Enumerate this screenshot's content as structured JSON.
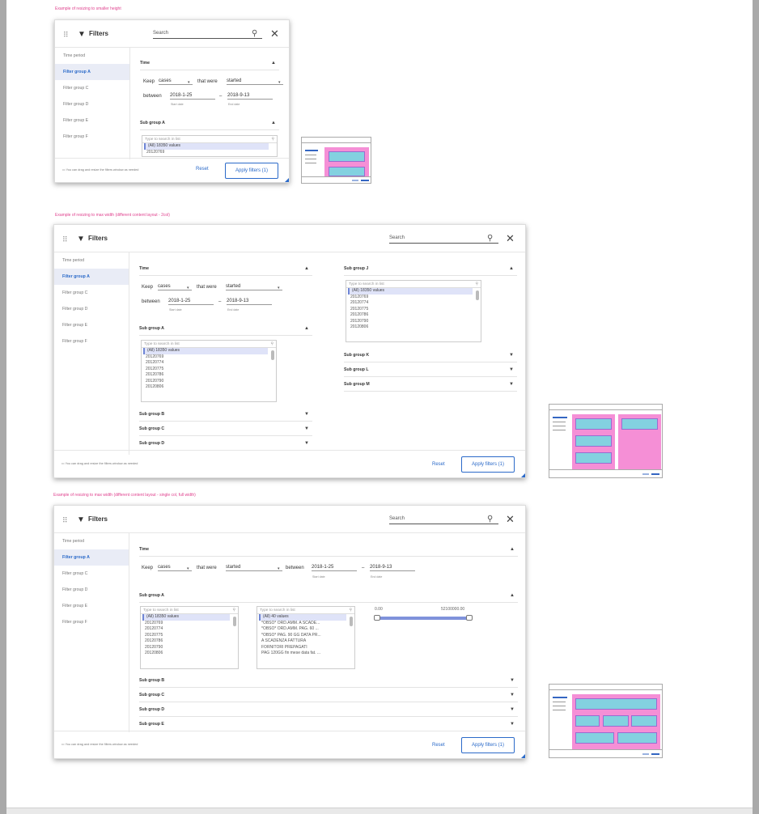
{
  "sections": [
    {
      "title": "Example of resizing to smaller height"
    },
    {
      "title": "Example of resizing to max width (different content layout - 2col)"
    },
    {
      "title": "Example of resizing to max width (different content layout - single col, full width)"
    }
  ],
  "common": {
    "title": "Filters",
    "search_placeholder": "Search",
    "sidebar": [
      "Time period",
      "Filter group A",
      "Filter group C",
      "Filter group D",
      "Filter group E",
      "Filter group F"
    ],
    "time_label": "Time",
    "keep": "Keep",
    "cases": "cases",
    "that_were": "that were",
    "started": "started",
    "between": "between",
    "start_date": "2018-1-25",
    "dash": "–",
    "end_date": "2018-9-13",
    "start_caption": "Start date",
    "end_caption": "End date",
    "subgroup_a": "Sub group A",
    "list_placeholder": "Type to search in list",
    "list_rows": [
      "(All) 18350 values",
      "20120769",
      "20120774",
      "20120775",
      "20120786",
      "20120790",
      "20120806"
    ],
    "footer_hint": "You can drag and resize the filters window as needed",
    "reset": "Reset",
    "apply": "Apply filters (1)"
  },
  "w2_extra": {
    "subgroups_left": [
      "Sub group B",
      "Sub group C",
      "Sub group D"
    ],
    "subgroup_j": "Sub group J",
    "subgroups_right": [
      "Sub group K",
      "Sub group L",
      "Sub group M"
    ]
  },
  "w3_extra": {
    "list2_rows": [
      "(All) 40 values",
      "*OBSO* ORD.AMM. A SCADE...",
      "*OBSO* ORD.AMM. PAG. 60 ...",
      "*OBSO* PAG. 90 GG DATA PR...",
      "A SCADENZA FATTURA",
      "FORNITORI PREPAGATI",
      "PAG 120GG fin mese data fat. ..."
    ],
    "range_min": "0.00",
    "range_max": "52100000.00",
    "subgroups": [
      "Sub group B",
      "Sub group C",
      "Sub group D",
      "Sub group E"
    ]
  },
  "icons": {
    "grip": "drag-grip-icon",
    "filter": "funnel-icon",
    "search": "search-icon",
    "close": "close-icon",
    "chat": "comment-icon",
    "collapse": "triangle-up-icon",
    "expand": "triangle-down-icon"
  },
  "colors": {
    "accent": "#2b6ac9",
    "title_pink": "#e0438f",
    "thumb_pink": "#f58fd6",
    "thumb_cyan": "#83d1e0"
  }
}
